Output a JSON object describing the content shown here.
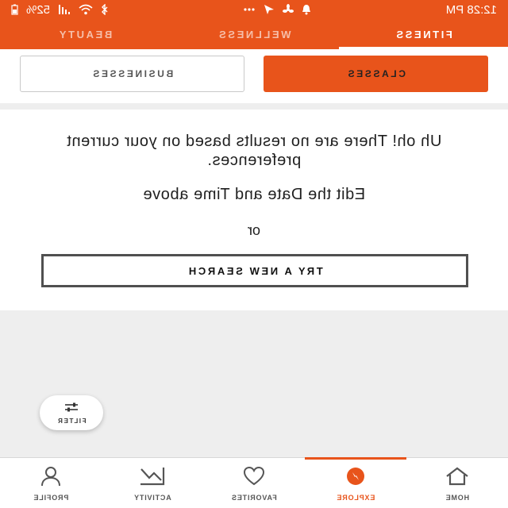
{
  "status_bar": {
    "time": "12:28 PM",
    "battery": "52%",
    "icons": [
      "bluetooth-icon",
      "wifi-icon",
      "signal-icon",
      "battery-icon",
      "more-dots-icon",
      "send-icon",
      "fan-icon",
      "notification-icon"
    ]
  },
  "tabs": [
    {
      "label": "FITNESS",
      "active": true
    },
    {
      "label": "WELLNESS",
      "active": false
    },
    {
      "label": "BEAUTY",
      "active": false
    }
  ],
  "segment": {
    "classes_label": "CLASSES",
    "businesses_label": "BUSINESSES"
  },
  "empty_state": {
    "message": "Uh oh! There are no results based on your current preferences.",
    "edit_hint": "Edit the Date and Time above",
    "or": "or",
    "try_button": "TRY A NEW SEARCH"
  },
  "filter": {
    "label": "FILTER",
    "icon": "sliders-icon"
  },
  "bottom_nav": {
    "home": "HOME",
    "explore": "EXPLORE",
    "favorites": "FAVORITES",
    "activity": "ACTIVITY",
    "profile": "PROFILE",
    "active": "explore"
  },
  "colors": {
    "accent": "#e8541b",
    "background": "#eeeeee"
  }
}
